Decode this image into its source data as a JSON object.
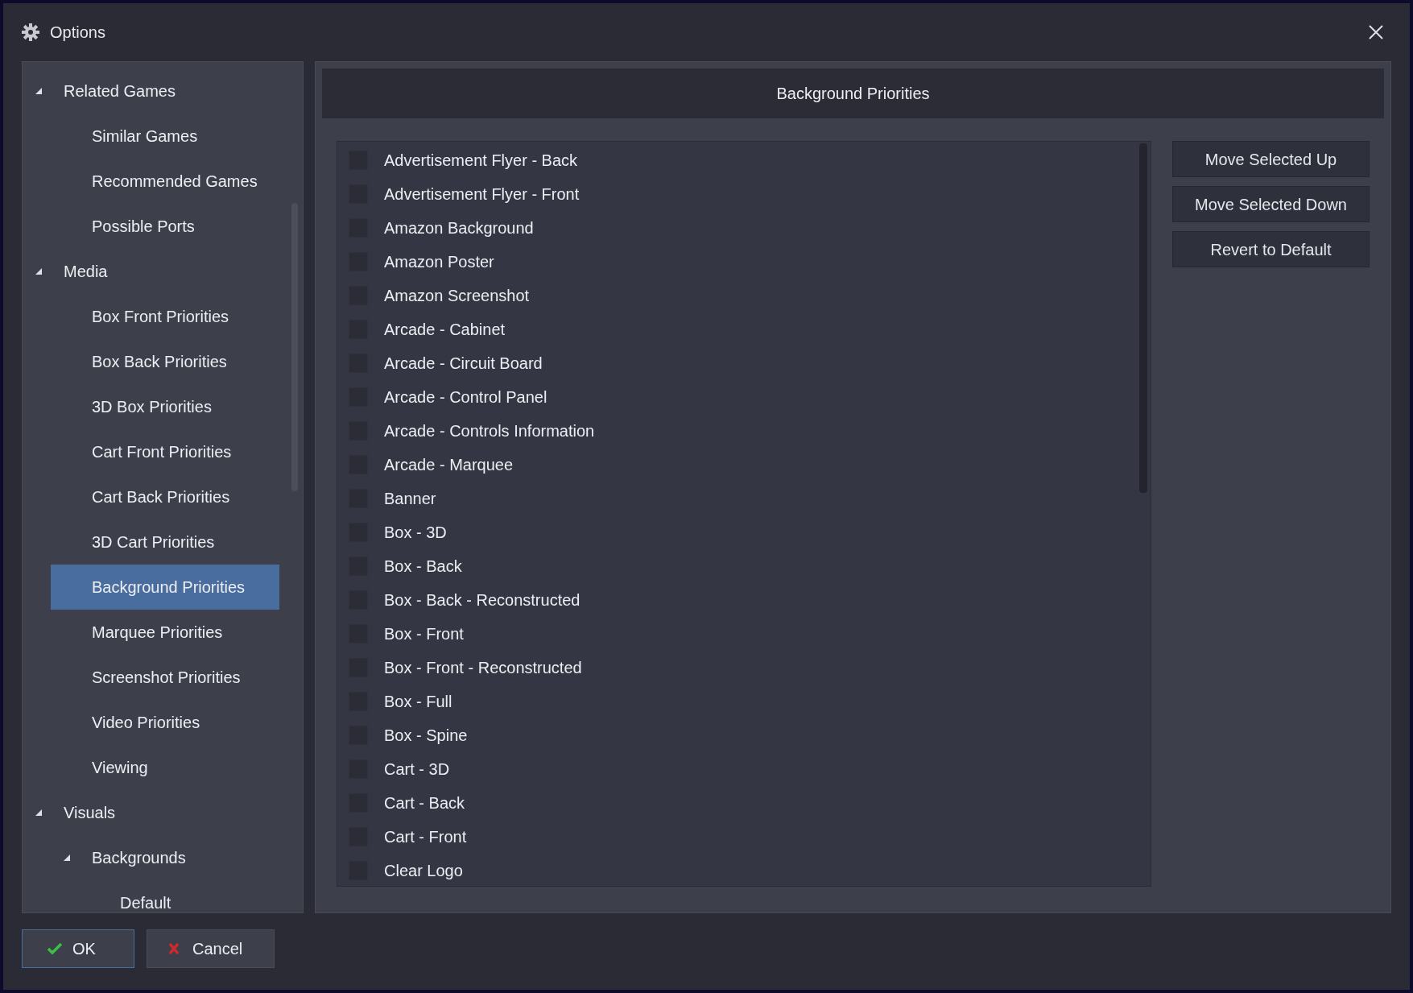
{
  "window": {
    "title": "Options"
  },
  "tree": [
    {
      "label": "Related Games",
      "expanded": true,
      "selected": false,
      "children": [
        {
          "label": "Similar Games",
          "selected": false
        },
        {
          "label": "Recommended Games",
          "selected": false
        },
        {
          "label": "Possible Ports",
          "selected": false
        }
      ]
    },
    {
      "label": "Media",
      "expanded": true,
      "selected": false,
      "children": [
        {
          "label": "Box Front Priorities",
          "selected": false
        },
        {
          "label": "Box Back Priorities",
          "selected": false
        },
        {
          "label": "3D Box Priorities",
          "selected": false
        },
        {
          "label": "Cart Front Priorities",
          "selected": false
        },
        {
          "label": "Cart Back Priorities",
          "selected": false
        },
        {
          "label": "3D Cart Priorities",
          "selected": false
        },
        {
          "label": "Background Priorities",
          "selected": true
        },
        {
          "label": "Marquee Priorities",
          "selected": false
        },
        {
          "label": "Screenshot Priorities",
          "selected": false
        },
        {
          "label": "Video Priorities",
          "selected": false
        },
        {
          "label": "Viewing",
          "selected": false
        }
      ]
    },
    {
      "label": "Visuals",
      "expanded": true,
      "selected": false,
      "children": [
        {
          "label": "Backgrounds",
          "expanded": true,
          "selected": false,
          "children": [
            {
              "label": "Default",
              "selected": false
            }
          ]
        }
      ]
    }
  ],
  "panel": {
    "title": "Background Priorities",
    "items": [
      {
        "label": "Advertisement Flyer - Back",
        "checked": false
      },
      {
        "label": "Advertisement Flyer - Front",
        "checked": false
      },
      {
        "label": "Amazon Background",
        "checked": false
      },
      {
        "label": "Amazon Poster",
        "checked": false
      },
      {
        "label": "Amazon Screenshot",
        "checked": false
      },
      {
        "label": "Arcade - Cabinet",
        "checked": false
      },
      {
        "label": "Arcade - Circuit Board",
        "checked": false
      },
      {
        "label": "Arcade - Control Panel",
        "checked": false
      },
      {
        "label": "Arcade - Controls Information",
        "checked": false
      },
      {
        "label": "Arcade - Marquee",
        "checked": false
      },
      {
        "label": "Banner",
        "checked": false
      },
      {
        "label": "Box - 3D",
        "checked": false
      },
      {
        "label": "Box - Back",
        "checked": false
      },
      {
        "label": "Box - Back - Reconstructed",
        "checked": false
      },
      {
        "label": "Box - Front",
        "checked": false
      },
      {
        "label": "Box - Front - Reconstructed",
        "checked": false
      },
      {
        "label": "Box - Full",
        "checked": false
      },
      {
        "label": "Box - Spine",
        "checked": false
      },
      {
        "label": "Cart - 3D",
        "checked": false
      },
      {
        "label": "Cart - Back",
        "checked": false
      },
      {
        "label": "Cart - Front",
        "checked": false
      },
      {
        "label": "Clear Logo",
        "checked": false
      }
    ],
    "buttons": [
      "Move Selected Up",
      "Move Selected Down",
      "Revert to Default"
    ]
  },
  "footer": [
    {
      "kind": "ok",
      "label": "OK"
    },
    {
      "kind": "cancel",
      "label": "Cancel"
    }
  ]
}
